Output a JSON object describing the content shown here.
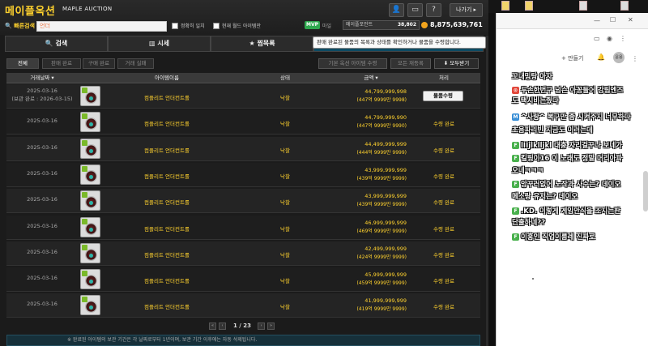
{
  "app": {
    "title": "메이플옥션",
    "subtitle": "MAPLE AUCTION",
    "exit_label": "나가기"
  },
  "header_buttons": [
    {
      "icon": "person-icon",
      "glyph": "👤"
    },
    {
      "icon": "inbox-icon",
      "glyph": "▭"
    },
    {
      "icon": "help-icon",
      "glyph": "?"
    }
  ],
  "search": {
    "label": "빠른검색",
    "value": "언더",
    "opt_exact": "정확히 일치",
    "opt_world": "현재 월드 아이템만"
  },
  "account": {
    "mvp": "MVP",
    "maple_label": "마일",
    "points_label": "메이플포인트",
    "points_value": "38,802",
    "meso": "8,875,639,761"
  },
  "nav": [
    {
      "label": "검색",
      "icon": "search-icon",
      "glyph": "🔍"
    },
    {
      "label": "시세",
      "icon": "chart-icon",
      "glyph": "▥"
    },
    {
      "label": "찜목록",
      "icon": "star-icon",
      "glyph": "★"
    },
    {
      "label": "",
      "icon": "",
      "glyph": ""
    }
  ],
  "tooltip": "판매 완료된 물품의 목록과 상태를 확인하거나 물품을 수령합니다.",
  "subtabs": [
    "전체",
    "판매 완료",
    "구매 완료",
    "거래 실패"
  ],
  "actions": {
    "bulk_sort": "기본 옥션 아이템 수령",
    "delete": "모든 재등록",
    "receive_all": "모두받기"
  },
  "columns": {
    "date": "거래날짜",
    "item": "아이템이름",
    "state": "상태",
    "price": "금액",
    "action": "처리"
  },
  "rows": [
    {
      "date": "2025-03-16",
      "date2": "(보관 완료 : 2026-03-15)",
      "item": "컴플리트 언더컨트롤",
      "state": "낙찰",
      "price": "44,799,999,998",
      "price2": "(447억 9999만 9998)",
      "action": "물품수령",
      "button": true
    },
    {
      "date": "2025-03-16",
      "date2": "",
      "item": "컴플리트 언더컨트롤",
      "state": "낙찰",
      "price": "44,799,999,990",
      "price2": "(447억 9999만 9990)",
      "action": "수령 완료",
      "button": false
    },
    {
      "date": "2025-03-16",
      "date2": "",
      "item": "컴플리트 언더컨트롤",
      "state": "낙찰",
      "price": "44,499,999,999",
      "price2": "(444억 9999만 9999)",
      "action": "수령 완료",
      "button": false
    },
    {
      "date": "2025-03-16",
      "date2": "",
      "item": "컴플리트 언더컨트롤",
      "state": "낙찰",
      "price": "43,999,999,999",
      "price2": "(439억 9999만 9999)",
      "action": "수령 완료",
      "button": false
    },
    {
      "date": "2025-03-16",
      "date2": "",
      "item": "컴플리트 언더컨트롤",
      "state": "낙찰",
      "price": "43,999,999,999",
      "price2": "(439억 9999만 9999)",
      "action": "수령 완료",
      "button": false
    },
    {
      "date": "2025-03-16",
      "date2": "",
      "item": "컴플리트 언더컨트롤",
      "state": "낙찰",
      "price": "46,999,999,999",
      "price2": "(469억 9999만 9999)",
      "action": "수령 완료",
      "button": false
    },
    {
      "date": "2025-03-16",
      "date2": "",
      "item": "컴플리트 언더컨트롤",
      "state": "낙찰",
      "price": "42,499,999,999",
      "price2": "(424억 9999만 9999)",
      "action": "수령 완료",
      "button": false
    },
    {
      "date": "2025-03-16",
      "date2": "",
      "item": "컴플리트 언더컨트롤",
      "state": "낙찰",
      "price": "45,999,999,999",
      "price2": "(459억 9999만 9999)",
      "action": "수령 완료",
      "button": false
    },
    {
      "date": "2025-03-16",
      "date2": "",
      "item": "컴플리트 언더컨트롤",
      "state": "낙찰",
      "price": "41,999,999,999",
      "price2": "(419억 9999만 9999)",
      "action": "수령 완료",
      "button": false
    }
  ],
  "pager": {
    "text": "1 / 23"
  },
  "notice": "※ 완료된 아이템의 보관 기간은 각 날짜로부터 1년이며, 보관 기간 이후에는 자동 삭제됩니다.",
  "chrome": {
    "make_label": "+ 만들기",
    "avatar": "윤용"
  },
  "desktop_icons": [
    "1",
    "2",
    "3",
    "4"
  ],
  "chat": [
    {
      "badge": "",
      "color": "",
      "text": "꼬내밍탕 아자"
    },
    {
      "badge": "⊙",
      "color": "#e2473b",
      "text": "두손한번구 넘슨 아꽁들어 강림엔즈"
    },
    {
      "badge": "",
      "color": "",
      "text": "도 택시비는줬다"
    },
    {
      "badge": "M",
      "color": "#3a8fd6",
      "text": "^사랑^ 복구만 좀 시켜주지 너무하다"
    },
    {
      "badge": "",
      "color": "",
      "text": "초음파리빈 지금도 이러는데"
    },
    {
      "badge": "F",
      "color": "#49b04d",
      "text": "lIIjlklljkl 대충 자리걸꾸나 보네가"
    },
    {
      "badge": "F",
      "color": "#49b04d",
      "text": "킬링이16 이 노래도 정말 머리아파"
    },
    {
      "badge": "",
      "color": "",
      "text": "오네ㅋㅋㅋ"
    },
    {
      "badge": "F",
      "color": "#49b04d",
      "text": "앙꾸러없어 노작과 사수는? 데이오"
    },
    {
      "badge": "",
      "color": "",
      "text": "메소랑 유저는? 데이오"
    },
    {
      "badge": "F",
      "color": "#49b04d",
      "text": ".KD. 이렇게 게임안식을 조지는판"
    },
    {
      "badge": "",
      "color": "",
      "text": "단출하네??"
    },
    {
      "badge": "F",
      "color": "#49b04d",
      "text": "이흥인 직업이름레 진짜로"
    }
  ]
}
